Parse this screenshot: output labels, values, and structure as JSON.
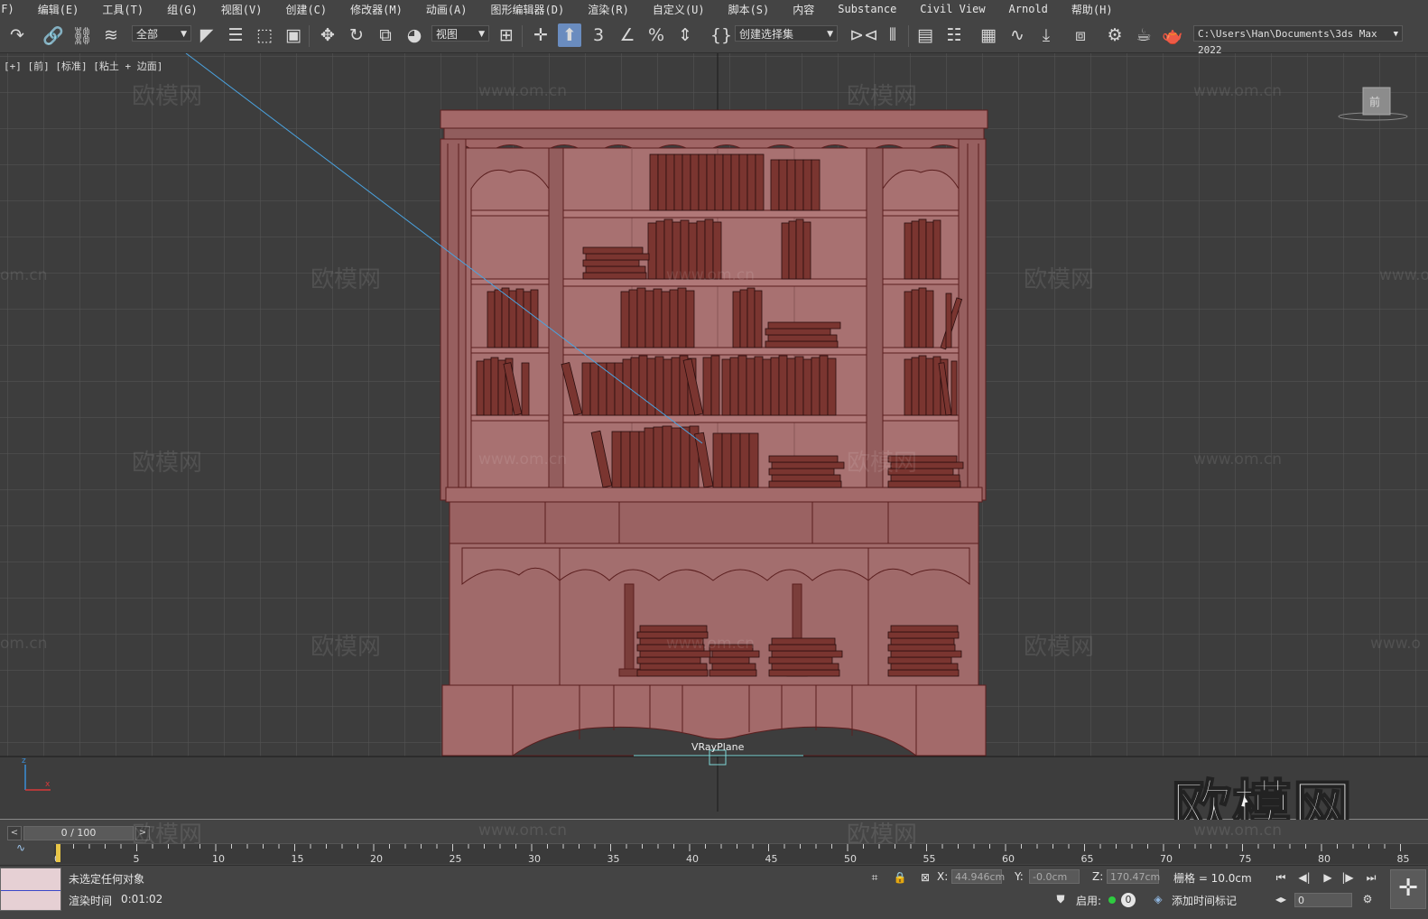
{
  "menu": [
    "(F)",
    "编辑(E)",
    "工具(T)",
    "组(G)",
    "视图(V)",
    "创建(C)",
    "修改器(M)",
    "动画(A)",
    "图形编辑器(D)",
    "渲染(R)",
    "自定义(U)",
    "脚本(S)",
    "内容",
    "Substance",
    "Civil View",
    "Arnold",
    "帮助(H)"
  ],
  "toolbar": {
    "selection_filter": "全部",
    "ref_coord": "视图",
    "named_selection": "创建选择集",
    "project_path": "C:\\Users\\Han\\Documents\\3ds Max 2022"
  },
  "viewport": {
    "label": "[+] [前] [标准] [粘土 + 边面]",
    "object_label": "VRayPlane",
    "viewcube_text": "前",
    "watermark_text": "欧模网",
    "watermark_url": "www.om.cn",
    "watermark_url_partial": "om.cn",
    "watermark_url_partial_right": "www.o"
  },
  "timeline": {
    "frame_display": "0 / 100",
    "prev": "<",
    "next": ">",
    "ticks": [
      0,
      5,
      10,
      15,
      20,
      25,
      30,
      35,
      40,
      45,
      50,
      55,
      60,
      65,
      70,
      75,
      80,
      85
    ]
  },
  "status": {
    "selection": "未选定任何对象",
    "render_time_label": "渲染时间",
    "render_time": "0:01:02",
    "x_label": "X:",
    "x_value": "44.946cm",
    "y_label": "Y:",
    "y_value": "-0.0cm",
    "z_label": "Z:",
    "z_value": "170.47cm",
    "grid": "栅格 = 10.0cm",
    "enable_label": "启用:",
    "add_time_tag": "添加时间标记",
    "counter": "0",
    "frame_field": "0"
  },
  "brand_watermark": "欧模网",
  "colors": {
    "model_fill": "#9c6666",
    "model_edge": "#5a1e1e",
    "book_fill": "#7a3530",
    "book_edge": "#2a0e0e",
    "viewport_bg": "#3d3d3d",
    "grid": "#555555",
    "active_button": "#6a8cbf"
  }
}
